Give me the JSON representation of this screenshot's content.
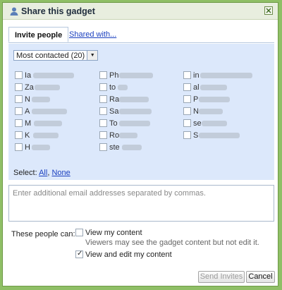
{
  "dialog": {
    "title": "Share this gadget"
  },
  "tabs": {
    "invite": "Invite people",
    "shared": "Shared with..."
  },
  "contacts": {
    "dropdown": "Most contacted (20)",
    "columns": [
      [
        "Ia",
        "Za",
        "N",
        "A",
        "M",
        "K",
        "H"
      ],
      [
        "Ph",
        "to",
        "Ra",
        "Sa",
        "To",
        "Ro",
        "ste"
      ],
      [
        "in",
        "al",
        "P",
        "N",
        "se",
        "S"
      ]
    ]
  },
  "select": {
    "label": "Select:",
    "all": "All",
    "none": "None"
  },
  "emails": {
    "placeholder": "Enter additional email addresses separated by commas."
  },
  "permissions": {
    "label": "These people can:",
    "view": "View my content",
    "view_note": "Viewers may see the gadget content but not edit it.",
    "edit": "View and edit my content"
  },
  "buttons": {
    "send": "Send Invites",
    "cancel": "Cancel"
  }
}
